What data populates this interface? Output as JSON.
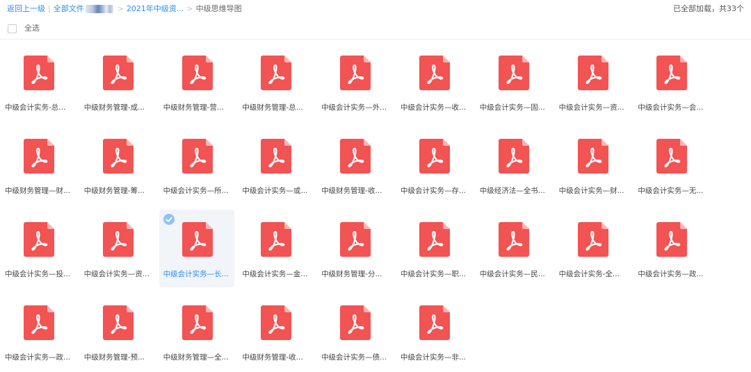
{
  "breadcrumb": {
    "back": "返回上一级",
    "root": "全部文件",
    "folder": "2021年中级资...",
    "current": "中级思维导图",
    "separator_bar": "|",
    "separator": ">"
  },
  "status": "已全部加载，共33个",
  "select_all_label": "全选",
  "colors": {
    "pdf": "#f25353",
    "link": "#2a8ef1",
    "selected_bg": "#f1f4f9"
  },
  "file_icon": "pdf-file-icon",
  "files": [
    {
      "name": "中级会计实务-总..."
    },
    {
      "name": "中级财务管理-成..."
    },
    {
      "name": "中级财务管理-营..."
    },
    {
      "name": "中级财务管理-总..."
    },
    {
      "name": "中级会计实务—外..."
    },
    {
      "name": "中级会计实务—收..."
    },
    {
      "name": "中级会计实务—固..."
    },
    {
      "name": "中级会计实务—资..."
    },
    {
      "name": "中级会计实务—会..."
    },
    {
      "name": "中级财务管理—财..."
    },
    {
      "name": "中级财务管理-筹..."
    },
    {
      "name": "中级会计实务—所..."
    },
    {
      "name": "中级会计实务—或..."
    },
    {
      "name": "中级财务管理-收..."
    },
    {
      "name": "中级会计实务—存..."
    },
    {
      "name": "中级经济法—全书..."
    },
    {
      "name": "中级会计实务—财..."
    },
    {
      "name": "中级会计实务—无..."
    },
    {
      "name": "中级会计实务—投..."
    },
    {
      "name": "中级会计实务—资..."
    },
    {
      "name": "中级会计实务—长...",
      "selected": true
    },
    {
      "name": "中级会计实务—金..."
    },
    {
      "name": "中级财务管理-分..."
    },
    {
      "name": "中级会计实务—职..."
    },
    {
      "name": "中级会计实务—民..."
    },
    {
      "name": "中级会计实务-全..."
    },
    {
      "name": "中级会计实务—政..."
    },
    {
      "name": "中级会计实务—政..."
    },
    {
      "name": "中级财务管理-预..."
    },
    {
      "name": "中级财务管理—全..."
    },
    {
      "name": "中级财务管理-收..."
    },
    {
      "name": "中级会计实务—债..."
    },
    {
      "name": "中级会计实务—非..."
    }
  ]
}
